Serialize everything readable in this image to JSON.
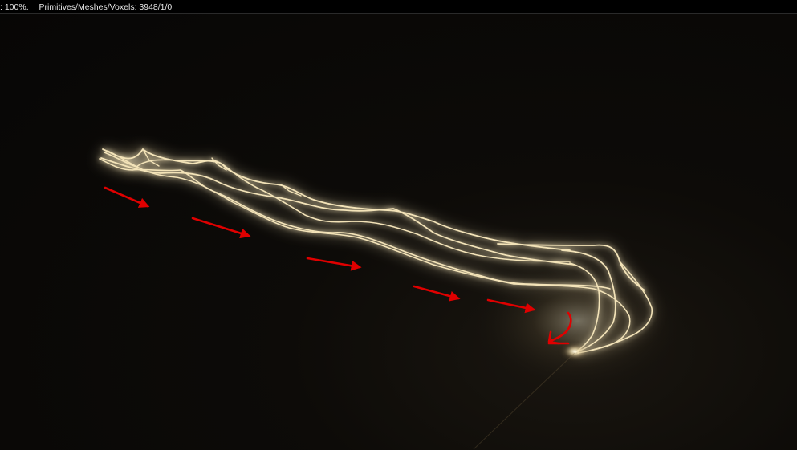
{
  "statusbar": {
    "zoom": ": 100%.",
    "counts": "Primitives/Meshes/Voxels: 3948/1/0"
  },
  "render": {
    "background": "#0a0907",
    "glow_color": "#f3e3b8",
    "core_color": "#fffdf3",
    "annotation_color": "#e00000"
  },
  "annotations": {
    "arrows": 5,
    "direction": "flow-right",
    "curl_marker": "turn-down"
  }
}
